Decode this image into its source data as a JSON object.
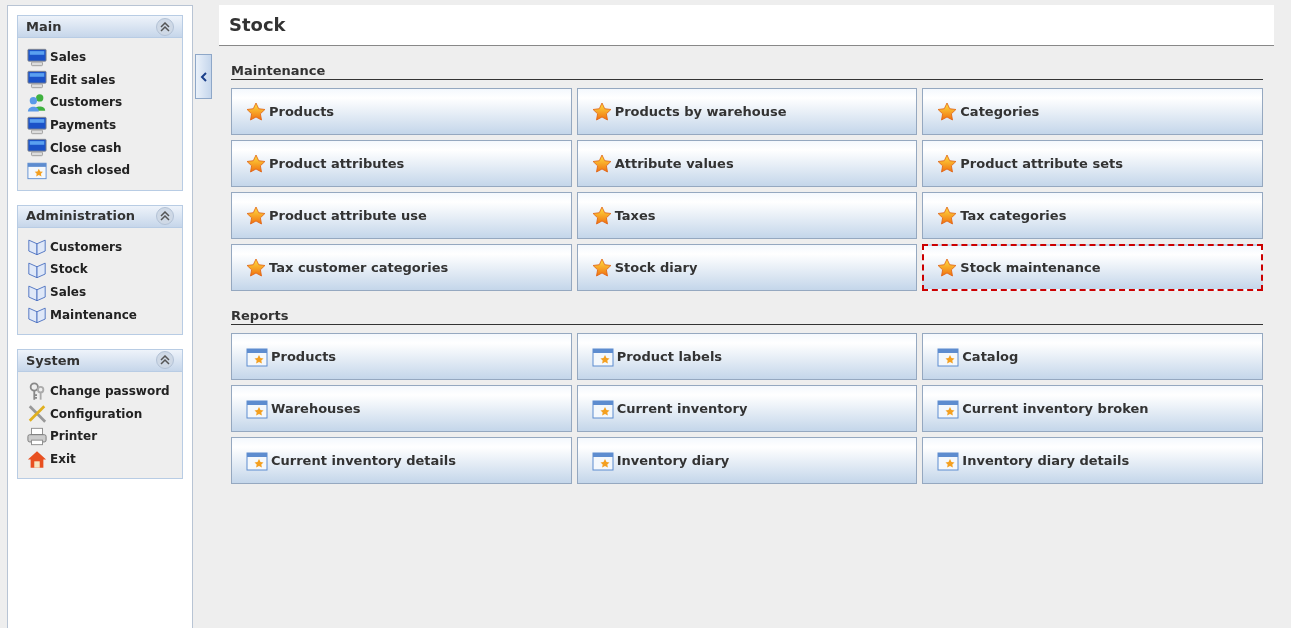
{
  "sidebar": {
    "panels": [
      {
        "title": "Main",
        "expanded": true,
        "items": [
          {
            "label": "Sales",
            "kind": "monitor"
          },
          {
            "label": "Edit sales",
            "kind": "monitor"
          },
          {
            "label": "Customers",
            "kind": "people"
          },
          {
            "label": "Payments",
            "kind": "monitor"
          },
          {
            "label": "Close cash",
            "kind": "monitor"
          },
          {
            "label": "Cash closed",
            "kind": "calendar"
          }
        ]
      },
      {
        "title": "Administration",
        "expanded": true,
        "items": [
          {
            "label": "Customers",
            "kind": "book"
          },
          {
            "label": "Stock",
            "kind": "book"
          },
          {
            "label": "Sales",
            "kind": "book"
          },
          {
            "label": "Maintenance",
            "kind": "book"
          }
        ]
      },
      {
        "title": "System",
        "expanded": true,
        "items": [
          {
            "label": "Change password",
            "kind": "keys"
          },
          {
            "label": "Configuration",
            "kind": "tools"
          },
          {
            "label": "Printer",
            "kind": "printer"
          },
          {
            "label": "Exit",
            "kind": "house"
          }
        ]
      }
    ]
  },
  "page": {
    "title": "Stock",
    "sections": [
      {
        "title": "Maintenance",
        "buttons": [
          {
            "label": "Products",
            "kind": "star",
            "focused": false
          },
          {
            "label": "Products by warehouse",
            "kind": "star",
            "focused": false
          },
          {
            "label": "Categories",
            "kind": "star",
            "focused": false
          },
          {
            "label": "Product attributes",
            "kind": "star",
            "focused": false
          },
          {
            "label": "Attribute values",
            "kind": "star",
            "focused": false
          },
          {
            "label": "Product attribute sets",
            "kind": "star",
            "focused": false
          },
          {
            "label": "Product attribute use",
            "kind": "star",
            "focused": false
          },
          {
            "label": "Taxes",
            "kind": "star",
            "focused": false
          },
          {
            "label": "Tax categories",
            "kind": "star",
            "focused": false
          },
          {
            "label": "Tax customer categories",
            "kind": "star",
            "focused": false
          },
          {
            "label": "Stock diary",
            "kind": "star",
            "focused": false
          },
          {
            "label": "Stock maintenance",
            "kind": "star",
            "focused": true
          }
        ]
      },
      {
        "title": "Reports",
        "buttons": [
          {
            "label": "Products",
            "kind": "report",
            "focused": false
          },
          {
            "label": "Product labels",
            "kind": "report",
            "focused": false
          },
          {
            "label": "Catalog",
            "kind": "report",
            "focused": false
          },
          {
            "label": "Warehouses",
            "kind": "report",
            "focused": false
          },
          {
            "label": "Current inventory",
            "kind": "report",
            "focused": false
          },
          {
            "label": "Current inventory broken",
            "kind": "report",
            "focused": false
          },
          {
            "label": "Current inventory details",
            "kind": "report",
            "focused": false
          },
          {
            "label": "Inventory diary",
            "kind": "report",
            "focused": false
          },
          {
            "label": "Inventory diary details",
            "kind": "report",
            "focused": false
          }
        ]
      }
    ]
  }
}
